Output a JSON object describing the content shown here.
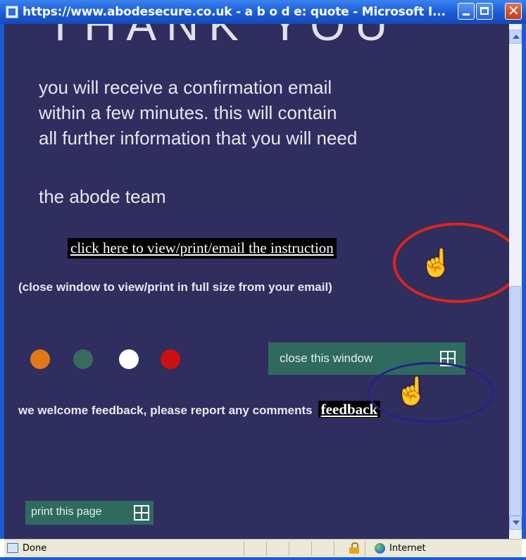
{
  "window": {
    "title": "https://www.abodesecure.co.uk - a b o d e: quote - Microsoft I..."
  },
  "page": {
    "heading_fragment": "THANK YOU",
    "message_lines": [
      "you will receive a confirmation email",
      "within a few minutes.  this will contain",
      "all further information that you will need"
    ],
    "signoff": "the abode team",
    "view_link": "click here to view/print/email the instruction",
    "close_note": "(close window to view/print in full size from your email)",
    "close_window_label": "close this window",
    "feedback_text": "we welcome feedback, please report any comments",
    "feedback_link": "feedback",
    "print_label": "print this page"
  },
  "dots": [
    {
      "color": "#e07818"
    },
    {
      "color": "#3a6a5e"
    },
    {
      "color": "#ffffff"
    },
    {
      "color": "#cc1010"
    }
  ],
  "annotations": [
    {
      "color": "#e0241a"
    },
    {
      "color": "#2a1f8a"
    }
  ],
  "statusbar": {
    "status": "Done",
    "zone": "Internet"
  },
  "colors": {
    "background": "#2f2e5e",
    "button": "#2f6a5f",
    "titlebar": "#1b5bd6"
  }
}
